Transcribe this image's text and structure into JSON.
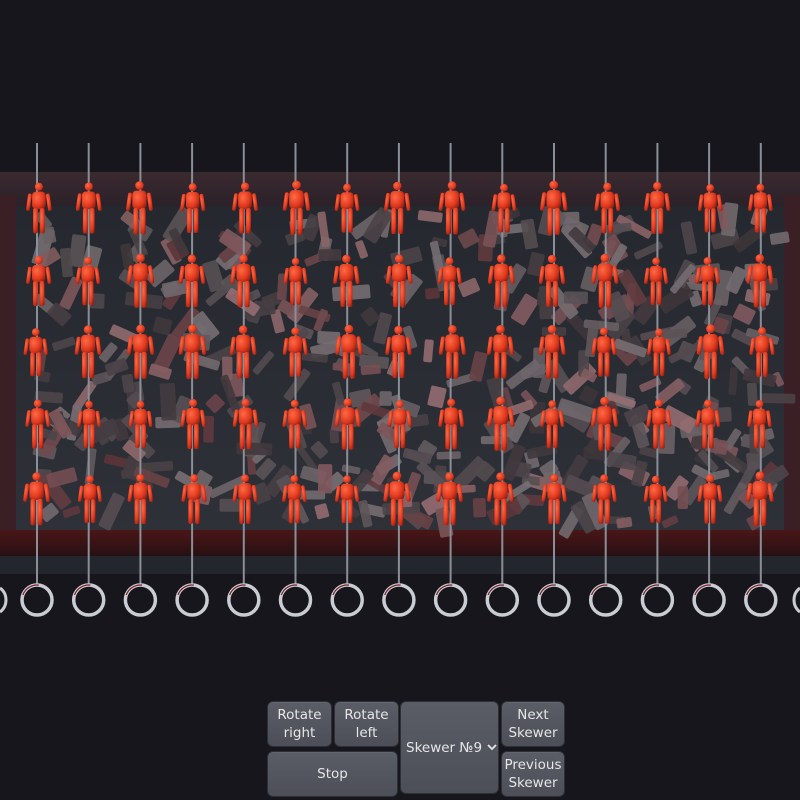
{
  "controls": {
    "rotate_right": "Rotate right",
    "rotate_left": "Rotate left",
    "stop": "Stop",
    "skewer_select": {
      "selected": "Skewer №9",
      "icon": "chevron-down-icon"
    },
    "next_skewer": "Next Skewer",
    "previous_skewer": "Previous Skewer"
  },
  "scene": {
    "skewer_count": 15,
    "figures_per_skewer": 5,
    "figure_color": "#e8381f",
    "rod_color": "#8a8e96",
    "background_color": "#16161c"
  }
}
